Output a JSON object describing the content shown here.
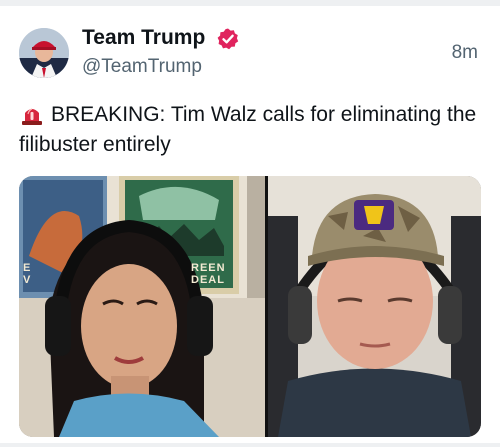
{
  "post": {
    "author_name": "Team Trump",
    "handle": "@TeamTrump",
    "timestamp": "8m",
    "text": "BREAKING: Tim Walz calls for eliminating the filibuster entirely"
  },
  "media": {
    "poster_text_line1": "REEN",
    "poster_text_line2": "DEAL",
    "poster_left_fragment_1": "E",
    "poster_left_fragment_2": "V"
  },
  "icons": {
    "verified": "verified-badge-icon",
    "alert": "rotating-light-icon"
  },
  "colors": {
    "verified_badge": "#e0245e",
    "alert": "#d7263d",
    "secondary_text": "#536471",
    "primary_text": "#0f1419"
  }
}
